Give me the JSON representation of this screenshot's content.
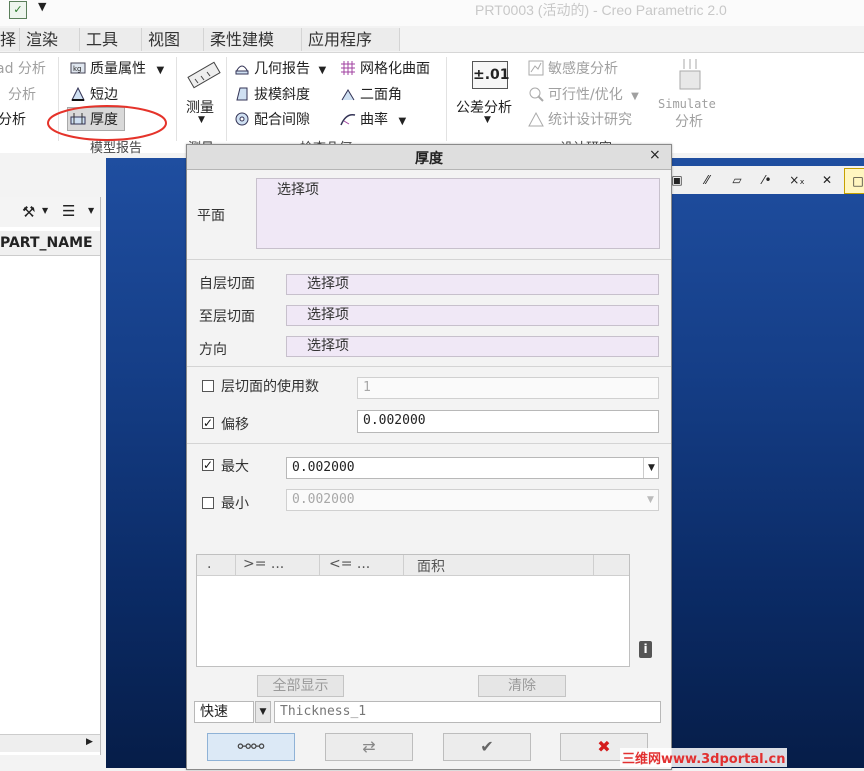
{
  "window": {
    "title": "PRT0003 (活动的) - Creo Parametric 2.0"
  },
  "menu_tabs": [
    "择",
    "渲染",
    "工具",
    "视图",
    "柔性建模",
    "应用程序"
  ],
  "ribbon": {
    "left_clip": [
      "ad 分析",
      "分析",
      "分析"
    ],
    "model_report": {
      "items": [
        "质量属性",
        "短边",
        "厚度"
      ],
      "label": "模型报告"
    },
    "measure": {
      "label": "测量",
      "group_label": "测量"
    },
    "inspect_geometry": {
      "items": [
        "几何报告",
        "拔模斜度",
        "配合间隙",
        "网格化曲面",
        "二面角",
        "曲率"
      ],
      "label": "检查几何"
    },
    "design_study": {
      "tolerance_icon": "±.01",
      "tolerance": "公差分析",
      "items": [
        "敏感度分析",
        "可行性/优化",
        "统计设计研究"
      ],
      "simulate_line1": "Simulate",
      "simulate_line2": "分析",
      "label": "设计研究"
    }
  },
  "left_panel": {
    "column_header": "PART_NAME"
  },
  "dialog": {
    "title": "厚度",
    "plane_label": "平面",
    "plane_value": "选择项",
    "from_slice_label": "自层切面",
    "from_slice_value": "选择项",
    "to_slice_label": "至层切面",
    "to_slice_value": "选择项",
    "direction_label": "方向",
    "direction_value": "选择项",
    "slice_count_label": "层切面的使用数",
    "slice_count_value": "1",
    "offset_label": "偏移",
    "offset_value": "0.002000",
    "max_label": "最大",
    "max_value": "0.002000",
    "min_label": "最小",
    "min_value": "0.002000",
    "table_headers": [
      ".",
      ">= ...",
      "<= ...",
      "面积"
    ],
    "show_all": "全部显示",
    "clear": "清除",
    "mode": "快速",
    "name_value": "Thickness_1"
  },
  "watermark": "三维网www.3dportal.cn"
}
